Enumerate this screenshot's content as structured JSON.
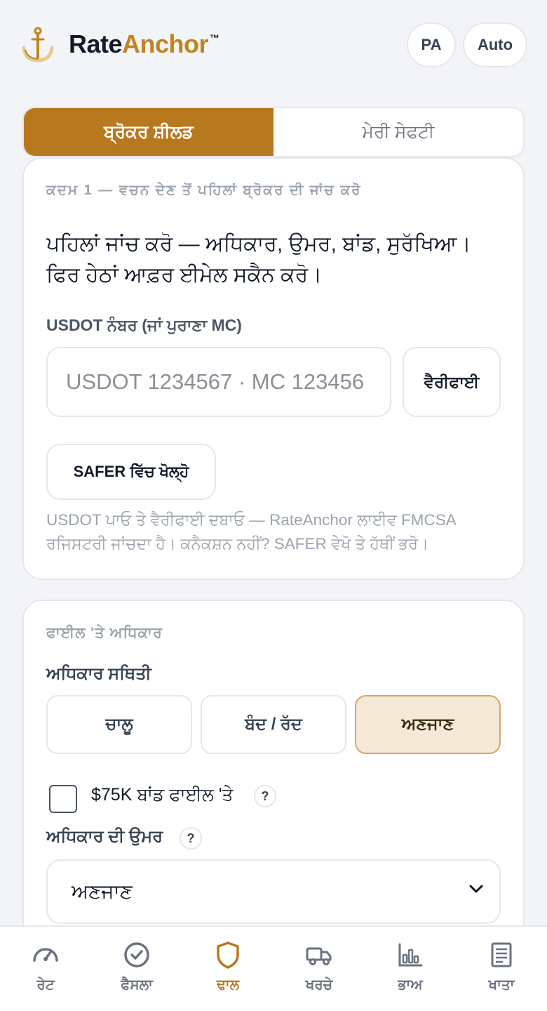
{
  "header": {
    "brand_part1": "Rate",
    "brand_part2": "Anchor",
    "trademark": "™",
    "lang_button": "PA",
    "theme_button": "Auto"
  },
  "tabs": {
    "active": "ਬ੍ਰੋਕਰ ਸ਼ੀਲਡ",
    "inactive": "ਮੇਰੀ ਸੇਫਟੀ"
  },
  "step_card": {
    "step_label": "ਕਦਮ 1 — ਵਚਨ ਦੇਣ ਤੋਂ ਪਹਿਲਾਂ ਬ੍ਰੋਕਰ ਦੀ ਜਾਂਚ ਕਰੋ",
    "headline": "ਪਹਿਲਾਂ ਜਾਂਚ ਕਰੋ — ਅਧਿਕਾਰ, ਉਮਰ, ਬਾਂਡ, ਸੁਰੱਖਿਆ। ਫਿਰ ਹੇਠਾਂ ਆਫ਼ਰ ਈਮੇਲ ਸਕੈਨ ਕਰੋ।",
    "field_label": "USDOT ਨੰਬਰ (ਜਾਂ ਪੁਰਾਣਾ MC)",
    "input_placeholder": "USDOT 1234567 · MC 123456",
    "verify_button": "ਵੈਰੀਫਾਈ",
    "safer_button": "SAFER ਵਿੱਚ ਖੋਲ੍ਹੋ",
    "help_text": "USDOT ਪਾਓ ਤੇ ਵੈਰੀਫਾਈ ਦਬਾਓ — RateAnchor ਲਾਈਵ FMCSA ਰਜਿਸਟਰੀ ਜਾਂਚਦਾ ਹੈ। ਕਨੈਕਸ਼ਨ ਨਹੀਂ? SAFER ਵੇਖੋ ਤੇ ਹੱਥੀਂ ਭਰੋ।"
  },
  "authority_card": {
    "section_label": "ਫਾਈਲ 'ਤੇ ਅਧਿਕਾਰ",
    "status_label": "ਅਧਿਕਾਰ ਸਥਿਤੀ",
    "status_options": [
      "ਚਾਲੂ",
      "ਬੰਦ / ਰੱਦ",
      "ਅਣਜਾਣ"
    ],
    "status_selected": "ਅਣਜਾਣ",
    "bond_label": "$75K ਬਾਂਡ ਫਾਈਲ 'ਤੇ",
    "bond_checked": false,
    "help_glyph": "?",
    "age_label": "ਅਧਿਕਾਰ ਦੀ ਉਮਰ",
    "age_value": "ਅਣਜਾਣ"
  },
  "bottom_nav": {
    "items": [
      {
        "label": "ਰੇਟ",
        "icon": "gauge-icon"
      },
      {
        "label": "ਫੈਸਲਾ",
        "icon": "check-circle-icon"
      },
      {
        "label": "ਢਾਲ",
        "icon": "shield-icon"
      },
      {
        "label": "ਖਰਚੇ",
        "icon": "truck-icon"
      },
      {
        "label": "ਭਾਅ",
        "icon": "bar-chart-icon"
      },
      {
        "label": "ਖਾਤਾ",
        "icon": "document-icon"
      }
    ],
    "active_index": 2
  },
  "colors": {
    "brand_gold": "#b8781e",
    "brand_dark": "#121a2b",
    "selected_bg": "#f5e9d8"
  }
}
